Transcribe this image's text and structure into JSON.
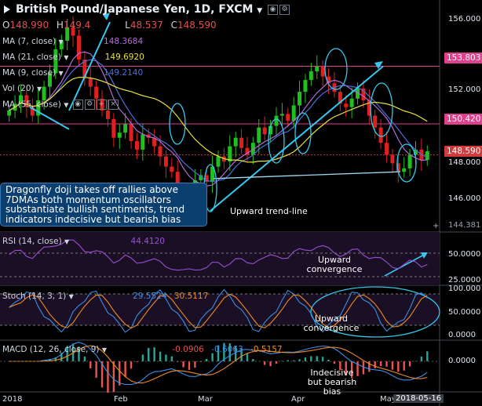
{
  "title": "British Pound/Japanese Yen, 1D, FXCM",
  "ohlc": {
    "o_label": "O",
    "o": "148.990",
    "h_label": "H",
    "h": "149.4",
    "l_label": "L",
    "l": "48.537",
    "c_label": "C",
    "c": "148.590"
  },
  "main_indicators": [
    {
      "label": "MA (7, close)",
      "value": "148.3684",
      "color": "#b36bd9"
    },
    {
      "label": "MA (21, close)",
      "value": "149.6920",
      "color": "#e8e23a"
    },
    {
      "label": "MA (9, close)",
      "value": "149.2140",
      "color": "#4e6fd6"
    },
    {
      "label": "Vol (20)",
      "value": "",
      "color": "#8a8a8a"
    },
    {
      "label": "MA (55, close)",
      "value": "",
      "color": "#d0d0d0"
    }
  ],
  "price_tags": [
    {
      "value": "153.803",
      "color": "#e0408e"
    },
    {
      "value": "150.420",
      "color": "#e0408e"
    },
    {
      "value": "148.590",
      "color": "#d23b3b"
    }
  ],
  "y_axis_main": [
    "156.000",
    "154.000",
    "152.000",
    "150.000",
    "148.000",
    "146.000",
    "144.381"
  ],
  "annotations": {
    "callout": "Dragonfly doji takes off rallies above 7DMAs both momentum oscillators substantiate bullish sentiments, trend indicators indecisive but bearish bias",
    "trendline": "Upward trend-line",
    "rsi_note": "Upward convergence",
    "stoch_note": "Upward convergence",
    "macd_note": "Indecisive but bearish bias"
  },
  "rsi": {
    "label": "RSI (14, close)",
    "value": "44.4120",
    "axis": [
      "50.0000",
      "25.0000"
    ]
  },
  "stoch": {
    "label": "Stoch (14, 3, 1)",
    "k": "29.5524",
    "d": "30.5117",
    "axis": [
      "100.000",
      "50.0000",
      "0.0000"
    ]
  },
  "macd": {
    "label": "MACD (12, 26, close, 9)",
    "v1": "-0.0906",
    "v2": "-0.6063",
    "v3": "-0.5157",
    "axis": [
      "0.0000"
    ]
  },
  "x_axis": [
    "2018",
    "Feb",
    "Mar",
    "Apr",
    "May",
    "2018-05-16"
  ],
  "chart_data": {
    "type": "candlestick",
    "title": "British Pound/Japanese Yen, 1D, FXCM",
    "ylim": [
      144.381,
      156.5
    ],
    "levels": [
      153.803,
      150.42,
      148.59
    ],
    "closes": [
      151.2,
      151.6,
      152.1,
      151.4,
      150.9,
      151.8,
      152.6,
      153.4,
      154.8,
      155.3,
      156.1,
      155.6,
      154.2,
      153.1,
      152.6,
      151.9,
      151.2,
      150.7,
      149.6,
      149.9,
      150.4,
      149.4,
      148.9,
      149.8,
      149.6,
      149.1,
      148.5,
      147.9,
      147.6,
      146.4,
      145.6,
      146.3,
      147.1,
      147.4,
      147.0,
      147.9,
      148.5,
      148.2,
      149.1,
      149.6,
      149.0,
      148.6,
      149.3,
      150.2,
      149.8,
      150.3,
      150.9,
      151.0,
      150.6,
      151.5,
      152.3,
      153.0,
      153.5,
      153.8,
      153.2,
      152.8,
      152.3,
      151.6,
      151.4,
      151.9,
      152.5,
      151.8,
      150.9,
      150.2,
      149.3,
      148.6,
      148.1,
      147.6,
      147.8,
      148.6,
      148.9,
      148.3,
      148.8
    ]
  }
}
